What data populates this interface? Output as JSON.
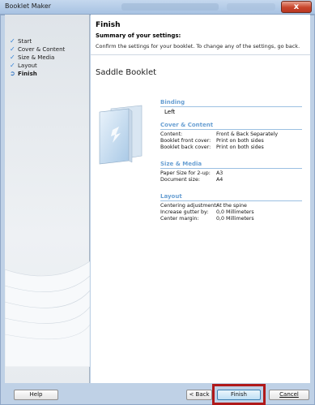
{
  "window": {
    "title": "Booklet Maker",
    "close_label": "x"
  },
  "sidebar": {
    "steps": [
      {
        "label": "Start",
        "state": "done"
      },
      {
        "label": "Cover & Content",
        "state": "done"
      },
      {
        "label": "Size & Media",
        "state": "done"
      },
      {
        "label": "Layout",
        "state": "done"
      },
      {
        "label": "Finish",
        "state": "current"
      }
    ],
    "icons": {
      "done": "check-icon",
      "current": "arrow-circle-icon"
    }
  },
  "main": {
    "header": "Finish",
    "summary_title": "Summary of your settings:",
    "instruction": "Confirm the settings for your booklet. To change any of the settings, go back.",
    "booklet_title": "Saddle Booklet",
    "sections": {
      "binding": {
        "title": "Binding",
        "value": "Left"
      },
      "cover_content": {
        "title": "Cover & Content",
        "rows": [
          {
            "key": "Content:",
            "value": "Front & Back Separately"
          },
          {
            "key": "Booklet front cover:",
            "value": "Print on both sides"
          },
          {
            "key": "Booklet back cover:",
            "value": "Print on both sides"
          }
        ]
      },
      "size_media": {
        "title": "Size & Media",
        "rows": [
          {
            "key": "Paper Size for 2-up:",
            "value": "A3"
          },
          {
            "key": "Document size:",
            "value": "A4"
          }
        ]
      },
      "layout": {
        "title": "Layout",
        "rows": [
          {
            "key": "Centering adjustment:",
            "value": "At the spine"
          },
          {
            "key": "Increase gutter by:",
            "value": "0,0 Millimeters"
          },
          {
            "key": "Center margin:",
            "value": "0,0 Millimeters"
          }
        ]
      }
    }
  },
  "buttons": {
    "help": "Help",
    "back": "< Back",
    "finish": "Finish",
    "cancel": "Cancel"
  },
  "colors": {
    "accent": "#6aa0d3",
    "highlight": "#b0191a",
    "check": "#2f7fd6"
  }
}
